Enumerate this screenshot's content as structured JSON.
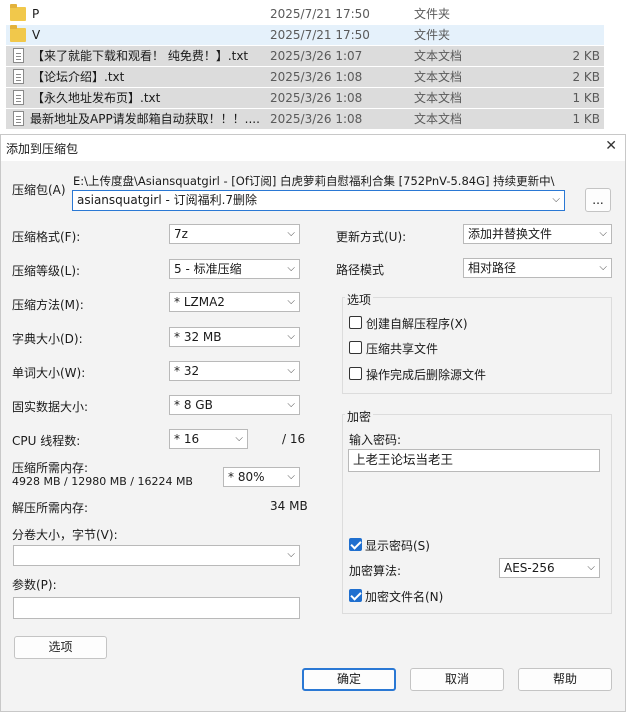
{
  "files": [
    {
      "name": "P",
      "date": "2025/7/21 17:50",
      "type": "文件夹",
      "size": "",
      "kind": "folder"
    },
    {
      "name": "V",
      "date": "2025/7/21 17:50",
      "type": "文件夹",
      "size": "",
      "kind": "folder"
    },
    {
      "name": "【来了就能下载和观看！ 纯免费！】.txt",
      "date": "2025/3/26 1:07",
      "type": "文本文档",
      "size": "2 KB",
      "kind": "doc"
    },
    {
      "name": "【论坛介绍】.txt",
      "date": "2025/3/26 1:08",
      "type": "文本文档",
      "size": "2 KB",
      "kind": "doc"
    },
    {
      "name": "【永久地址发布页】.txt",
      "date": "2025/3/26 1:08",
      "type": "文本文档",
      "size": "1 KB",
      "kind": "doc"
    },
    {
      "name": "最新地址及APP请发邮箱自动获取！！！....",
      "date": "2025/3/26 1:08",
      "type": "文本文档",
      "size": "1 KB",
      "kind": "doc"
    }
  ],
  "dialog": {
    "title": "添加到压缩包",
    "close": "✕",
    "archive_label": "压缩包(A)",
    "archive_path": "E:\\上传度盘\\Asiansquatgirl - [Of订阅] 白虎萝莉自慰福利合集 [752PnV-5.84G] 持续更新中\\",
    "archive_name": "asiansquatgirl - 订阅福利.7删除",
    "browse": "...",
    "format_label": "压缩格式(F):",
    "format_value": "7z",
    "level_label": "压缩等级(L):",
    "level_value": "5 - 标准压缩",
    "method_label": "压缩方法(M):",
    "method_value": "*  LZMA2",
    "dict_label": "字典大小(D):",
    "dict_value": "*  32 MB",
    "word_label": "单词大小(W):",
    "word_value": "*  32",
    "solid_label": "固实数据大小:",
    "solid_value": "*  8 GB",
    "cpu_label": "CPU 线程数:",
    "cpu_value": "*  16",
    "cpu_total": "/ 16",
    "mem_label": "压缩所需内存:",
    "mem_value": "4928 MB / 12980 MB / 16224 MB",
    "mem_pct": "*  80%",
    "dmem_label": "解压所需内存:",
    "dmem_value": "34 MB",
    "volume_label": "分卷大小，字节(V):",
    "volume_value": "",
    "params_label": "参数(P):",
    "params_value": "",
    "options_btn": "选项",
    "update_label": "更新方式(U):",
    "update_value": "添加并替换文件",
    "path_label": "路径模式",
    "path_value": "相对路径",
    "options_group": "选项",
    "opt_sfx": "创建自解压程序(X)",
    "opt_shared": "压缩共享文件",
    "opt_delete": "操作完成后删除源文件",
    "enc_group": "加密",
    "pwd_label": "输入密码:",
    "pwd_value": "上老王论坛当老王",
    "show_pwd": "显示密码(S)",
    "enc_method_label": "加密算法:",
    "enc_method_value": "AES-256",
    "enc_names": "加密文件名(N)",
    "ok": "确定",
    "cancel": "取消",
    "help": "帮助"
  },
  "colors": {
    "accent": "#2a78d4",
    "selected_row": "#dcdcdc",
    "hover_row": "#e5f1fb"
  }
}
